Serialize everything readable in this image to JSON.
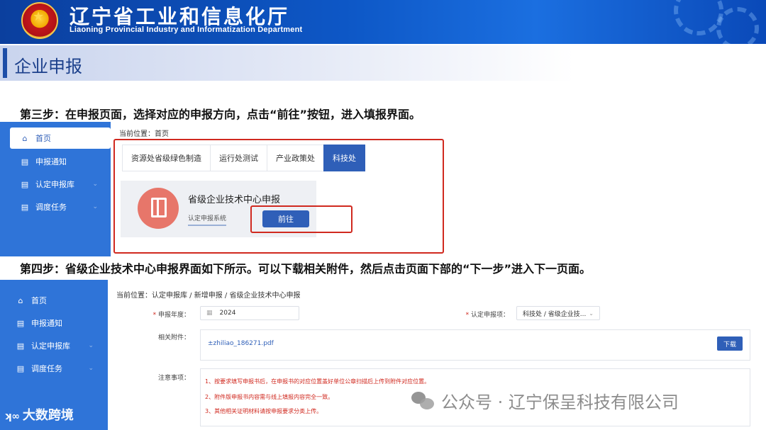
{
  "header": {
    "title": "辽宁省工业和信息化厅",
    "subtitle": "Liaoning Provincial Industry and Informatization Department"
  },
  "section": {
    "title": "企业申报"
  },
  "steps": {
    "step3": "第三步：在申报页面，选择对应的申报方向，点击“前往”按钮，进入填报界面。",
    "step4": "第四步：省级企业技术中心申报界面如下所示。可以下载相关附件，然后点击页面下部的“下一步”进入下一页面。"
  },
  "screen1": {
    "sidebar": [
      {
        "icon": "home-icon",
        "glyph": "⌂",
        "label": "首页"
      },
      {
        "icon": "notice-icon",
        "glyph": "▤",
        "label": "申报通知"
      },
      {
        "icon": "library-icon",
        "glyph": "▤",
        "label": "认定申报库"
      },
      {
        "icon": "task-icon",
        "glyph": "▤",
        "label": "调度任务"
      }
    ],
    "breadcrumb": "当前位置：首页",
    "tabs": [
      "资源处省级绿色制造",
      "运行处测试",
      "产业政策处",
      "科技处"
    ],
    "active_tab": "科技处",
    "card": {
      "title": "省级企业技术中心申报",
      "link": "认定申报系统",
      "button": "前往"
    }
  },
  "screen2": {
    "sidebar": [
      {
        "icon": "home-icon",
        "glyph": "⌂",
        "label": "首页"
      },
      {
        "icon": "notice-icon",
        "glyph": "▤",
        "label": "申报通知"
      },
      {
        "icon": "library-icon",
        "glyph": "▤",
        "label": "认定申报库"
      },
      {
        "icon": "task-icon",
        "glyph": "▤",
        "label": "调度任务"
      }
    ],
    "breadcrumb": "当前位置：认定申报库 / 新增申报 / 省级企业技术中心申报",
    "form": {
      "year_label": "申报年度：",
      "year_value": "2024",
      "item_label": "认定申报项：",
      "item_value": "科技处 / 省级企业技...",
      "attach_label": "相关附件：",
      "attach_file": "±zhiliao_186271.pdf",
      "download": "下载",
      "notes_label": "注意事项：",
      "notes": [
        "1、按要求填写申报书后，在申报书的对应位置盖好单位公章扫描后上传到附件对应位置。",
        "2、附件版申报书内容需与线上填报内容完全一致。",
        "3、其他相关证明材料请按申报要求分类上传。"
      ]
    }
  },
  "watermarks": {
    "right": "公众号 · 辽宁保呈科技有限公司",
    "left": "大数跨境"
  },
  "colors": {
    "primary": "#2f5fb8",
    "sidebar": "#2f74d8",
    "highlight": "#d0291f"
  }
}
